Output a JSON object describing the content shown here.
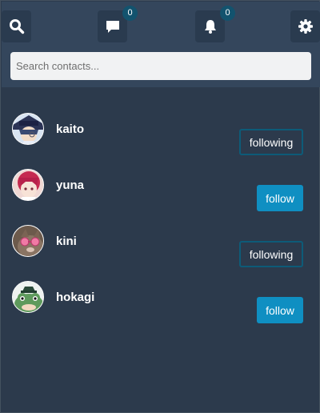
{
  "header": {
    "messages_count": "0",
    "notifications_count": "0",
    "search": {
      "placeholder": "Search contacts..."
    }
  },
  "contacts": [
    {
      "name": "kaito",
      "action": "following"
    },
    {
      "name": "yuna",
      "action": "follow"
    },
    {
      "name": "kini",
      "action": "following"
    },
    {
      "name": "hokagi",
      "action": "follow"
    }
  ],
  "colors": {
    "background": "#2c3a4c",
    "header": "#34465c",
    "follow_button": "#0f8fc2",
    "following_border": "#0d5b78",
    "badge": "#12536e"
  },
  "icons": {
    "search": "magnifier-icon",
    "messages": "chat-bubble-icon",
    "notifications": "bell-icon",
    "settings": "gear-icon"
  }
}
